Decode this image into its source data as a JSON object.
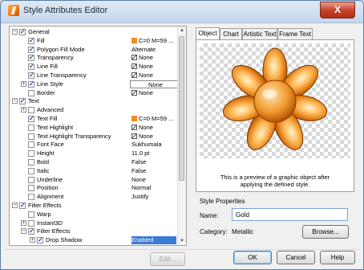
{
  "window": {
    "title": "Style Attributes Editor",
    "close_label": "X"
  },
  "tree": {
    "rows": [
      {
        "label": "General",
        "checked": true,
        "expander": "minus",
        "indent": 0,
        "value": ""
      },
      {
        "label": "Fill",
        "checked": true,
        "indent": 1,
        "value": "C=0 M=59 ...",
        "value_icon": "orange-swatch"
      },
      {
        "label": "Polygon Fill Mode",
        "checked": true,
        "indent": 1,
        "value": "Alternate"
      },
      {
        "label": "Transparency",
        "checked": true,
        "indent": 1,
        "value": "None",
        "value_icon": "none-icon"
      },
      {
        "label": "Line Fill",
        "checked": true,
        "indent": 1,
        "value": "None",
        "value_icon": "none-icon"
      },
      {
        "label": "Line Transparency",
        "checked": true,
        "indent": 1,
        "value": "None",
        "value_icon": "none-icon"
      },
      {
        "label": "Line Style",
        "checked": true,
        "expander": "plus",
        "indent": 1,
        "value": "None",
        "value_boxed": true
      },
      {
        "label": "Border",
        "checked": false,
        "indent": 1,
        "value": "None",
        "value_icon": "none-icon"
      },
      {
        "label": "Text",
        "checked": true,
        "expander": "minus",
        "indent": 0,
        "value": ""
      },
      {
        "label": "Advanced",
        "checked": false,
        "expander": "plus",
        "indent": 1,
        "value": ""
      },
      {
        "label": "Text Fill",
        "checked": true,
        "indent": 1,
        "value": "C=0 M=59 ...",
        "value_icon": "orange-swatch"
      },
      {
        "label": "Text Highlight",
        "checked": false,
        "indent": 1,
        "value": "None",
        "value_icon": "none-icon"
      },
      {
        "label": "Text Highlight Transparency",
        "checked": false,
        "indent": 1,
        "value": "None",
        "value_icon": "none-icon"
      },
      {
        "label": "Font Face",
        "checked": false,
        "indent": 1,
        "value": "Sukhumala"
      },
      {
        "label": "Height",
        "checked": false,
        "indent": 1,
        "value": "11.0 pt"
      },
      {
        "label": "Bold",
        "checked": false,
        "indent": 1,
        "value": "False"
      },
      {
        "label": "Italic",
        "checked": false,
        "indent": 1,
        "value": "False"
      },
      {
        "label": "Underline",
        "checked": false,
        "indent": 1,
        "value": "None"
      },
      {
        "label": "Position",
        "checked": false,
        "indent": 1,
        "value": "Normal"
      },
      {
        "label": "Alignment",
        "checked": false,
        "indent": 1,
        "value": "Justify"
      },
      {
        "label": "Filter Effects",
        "checked": true,
        "expander": "minus",
        "indent": 0,
        "value": ""
      },
      {
        "label": "Warp",
        "checked": false,
        "indent": 1,
        "value": ""
      },
      {
        "label": "Instant3D",
        "checked": false,
        "expander": "plus",
        "indent": 1,
        "value": ""
      },
      {
        "label": "Filter Effects",
        "checked": true,
        "expander": "minus",
        "indent": 1,
        "value": ""
      },
      {
        "label": "Drop Shadow",
        "checked": true,
        "expander": "plus",
        "indent": 2,
        "value": "Enabled",
        "value_selected": true
      }
    ]
  },
  "tabs": [
    "Object",
    "Chart",
    "Artistic Text",
    "Frame Text"
  ],
  "active_tab": "Object",
  "preview": {
    "caption_line1": "This is a preview of a graphic object after",
    "caption_line2": "applying the defined style."
  },
  "style_properties": {
    "title": "Style Properties",
    "name_label": "Name:",
    "name_value": "Gold",
    "category_label": "Category:",
    "category_value": "Metallic",
    "browse_label": "Browse..."
  },
  "buttons": {
    "edit": "Edit...",
    "ok": "OK",
    "cancel": "Cancel",
    "help": "Help"
  },
  "colors": {
    "swatch": "#f18c2a",
    "selection": "#3b7bd1",
    "gold_light": "#ffd08a",
    "gold_dark": "#b85408"
  }
}
